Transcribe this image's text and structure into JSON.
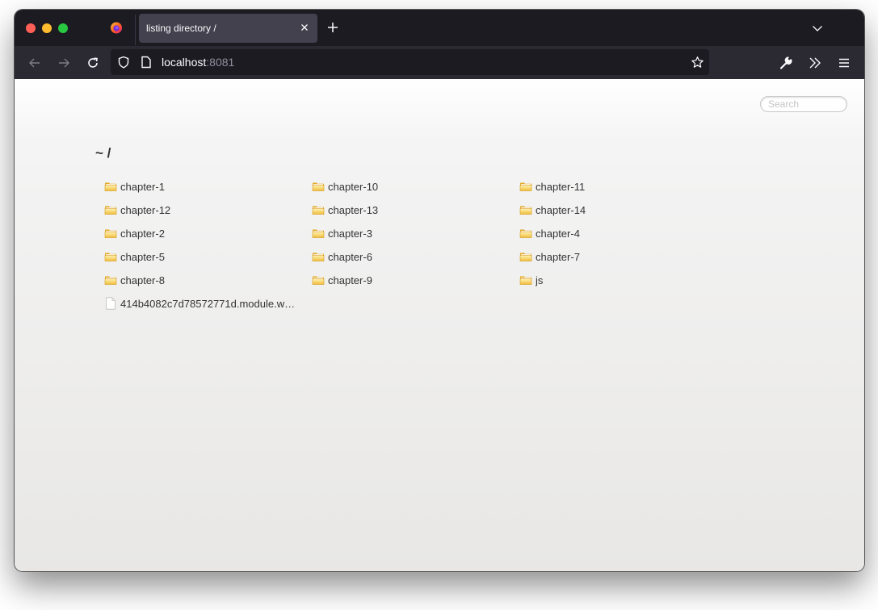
{
  "browser": {
    "tab": {
      "title": "listing directory /",
      "close_icon": "close-icon"
    },
    "new_tab_icon": "plus-icon",
    "tab_list_icon": "chevron-down-icon",
    "nav": {
      "back_icon": "arrow-left-icon",
      "forward_icon": "arrow-right-icon",
      "reload_icon": "reload-icon"
    },
    "url": {
      "host": "localhost",
      "port": ":8081"
    },
    "toolbar_icons": [
      "wrench-icon",
      "overflow-chevrons-icon",
      "hamburger-menu-icon"
    ]
  },
  "page": {
    "search": {
      "placeholder": "Search",
      "value": ""
    },
    "path": "~ /",
    "files": [
      {
        "name": "chapter-1",
        "type": "folder"
      },
      {
        "name": "chapter-10",
        "type": "folder"
      },
      {
        "name": "chapter-11",
        "type": "folder"
      },
      {
        "name": "chapter-12",
        "type": "folder"
      },
      {
        "name": "chapter-13",
        "type": "folder"
      },
      {
        "name": "chapter-14",
        "type": "folder"
      },
      {
        "name": "chapter-2",
        "type": "folder"
      },
      {
        "name": "chapter-3",
        "type": "folder"
      },
      {
        "name": "chapter-4",
        "type": "folder"
      },
      {
        "name": "chapter-5",
        "type": "folder"
      },
      {
        "name": "chapter-6",
        "type": "folder"
      },
      {
        "name": "chapter-7",
        "type": "folder"
      },
      {
        "name": "chapter-8",
        "type": "folder"
      },
      {
        "name": "chapter-9",
        "type": "folder"
      },
      {
        "name": "js",
        "type": "folder"
      },
      {
        "name": "414b4082c7d78572771d.module.w…",
        "type": "file"
      }
    ]
  }
}
